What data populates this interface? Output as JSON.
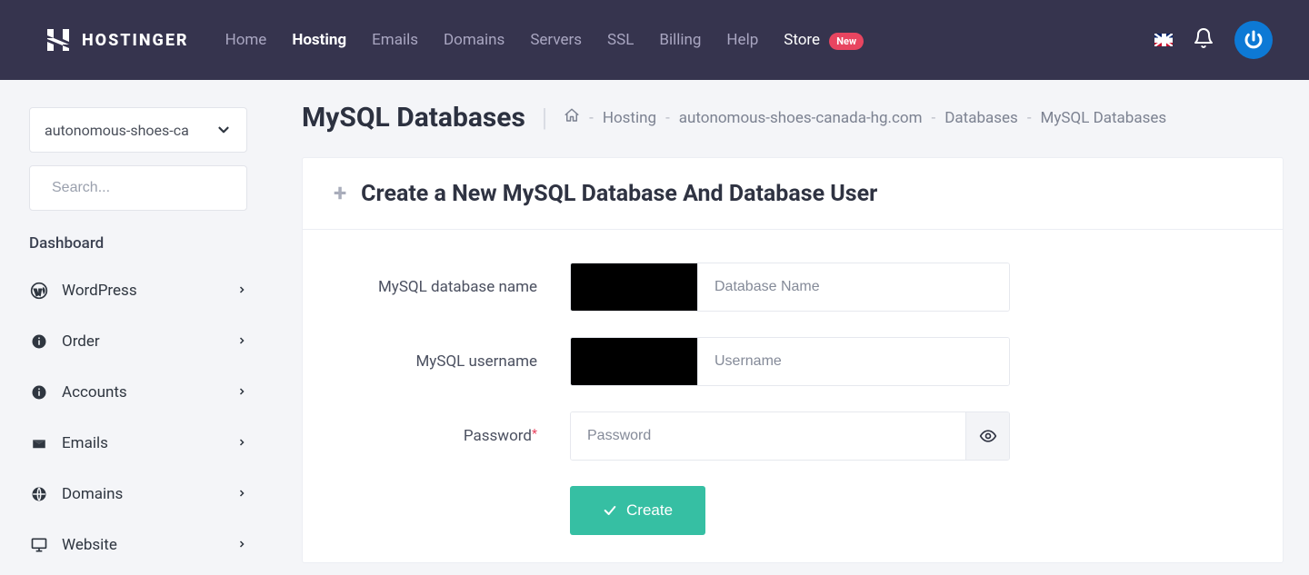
{
  "brand": "HOSTINGER",
  "nav": {
    "home": "Home",
    "hosting": "Hosting",
    "emails": "Emails",
    "domains": "Domains",
    "servers": "Servers",
    "ssl": "SSL",
    "billing": "Billing",
    "help": "Help",
    "store": "Store",
    "store_badge": "New"
  },
  "sidebar": {
    "site_selector": "autonomous-shoes-ca",
    "search_placeholder": "Search...",
    "heading": "Dashboard",
    "items": [
      {
        "label": "WordPress"
      },
      {
        "label": "Order"
      },
      {
        "label": "Accounts"
      },
      {
        "label": "Emails"
      },
      {
        "label": "Domains"
      },
      {
        "label": "Website"
      }
    ]
  },
  "page": {
    "title": "MySQL Databases",
    "breadcrumb": {
      "hosting": "Hosting",
      "domain": "autonomous-shoes-canada-hg.com",
      "databases": "Databases",
      "mysql": "MySQL Databases"
    }
  },
  "card": {
    "title": "Create a New MySQL Database And Database User",
    "labels": {
      "dbname": "MySQL database name",
      "username": "MySQL username",
      "password": "Password"
    },
    "placeholders": {
      "dbname": "Database Name",
      "username": "Username",
      "password": "Password"
    },
    "submit": "Create"
  }
}
